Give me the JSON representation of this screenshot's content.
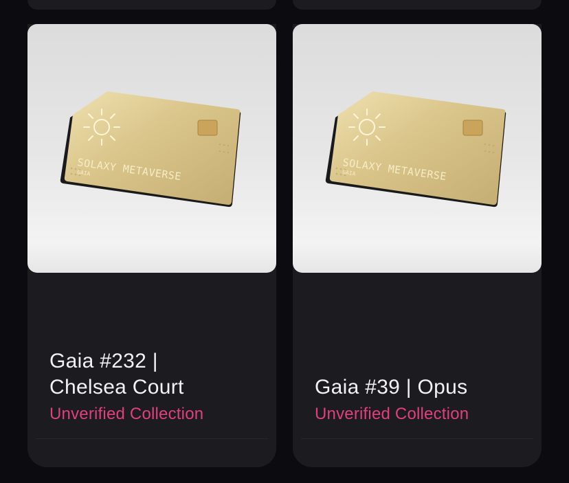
{
  "cards": [
    {
      "title_line1": "Gaia #232 |",
      "title_line2": "Chelsea Court",
      "collection": "Unverified Collection",
      "image": {
        "card_brand": "SOLAXY METAVERSE",
        "card_name": "GAIA"
      }
    },
    {
      "title_line1": "",
      "title_line2": "Gaia #39 | Opus",
      "collection": "Unverified Collection",
      "image": {
        "card_brand": "SOLAXY METAVERSE",
        "card_name": "GAIA"
      }
    }
  ],
  "colors": {
    "background": "#0c0c10",
    "card": "#1b1b20",
    "title": "#f2f2f4",
    "collection": "#e0407f",
    "card_gold": "#d8c48c"
  }
}
